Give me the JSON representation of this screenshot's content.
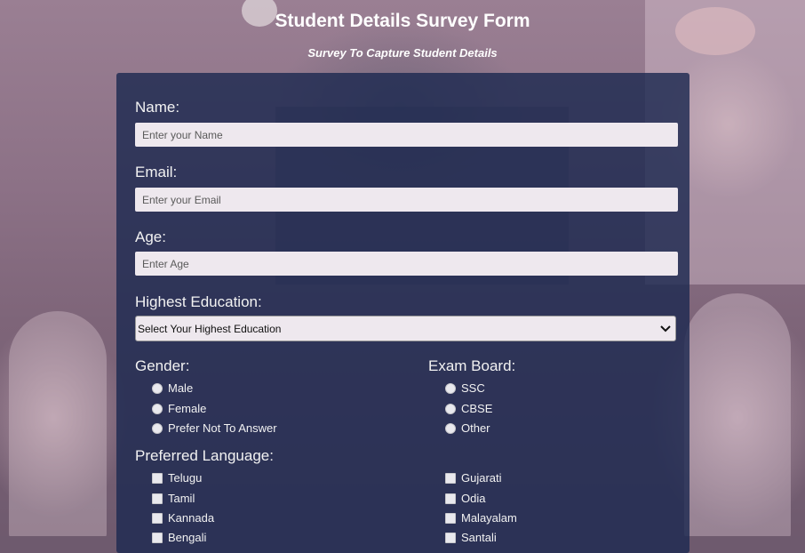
{
  "page": {
    "title": "Student Details Survey Form",
    "subtitle": "Survey To Capture Student Details"
  },
  "form": {
    "name": {
      "label": "Name:",
      "placeholder": "Enter your Name"
    },
    "email": {
      "label": "Email:",
      "placeholder": "Enter your Email"
    },
    "age": {
      "label": "Age:",
      "placeholder": "Enter Age"
    },
    "education": {
      "label": "Highest Education:",
      "selected": "Select Your Highest Education"
    },
    "gender": {
      "label": "Gender:",
      "options": [
        "Male",
        "Female",
        "Prefer Not To Answer"
      ]
    },
    "exam_board": {
      "label": "Exam Board:",
      "options": [
        "SSC",
        "CBSE",
        "Other"
      ]
    },
    "language": {
      "label": "Preferred Language:",
      "left": [
        "Telugu",
        "Tamil",
        "Kannada",
        "Bengali"
      ],
      "right": [
        "Gujarati",
        "Odia",
        "Malayalam",
        "Santali"
      ]
    }
  },
  "icons": {
    "select_arrow": "chevron-down-icon"
  },
  "colors": {
    "form_bg": "#1d2951",
    "input_bg": "#eee8ee",
    "text": "#ffffff"
  }
}
